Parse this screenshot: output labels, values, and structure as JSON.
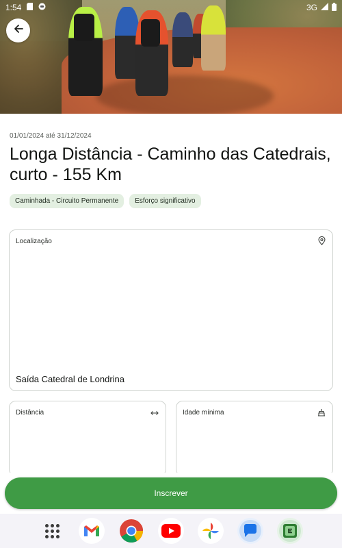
{
  "status_bar": {
    "time": "1:54",
    "network": "3G"
  },
  "hero": {
    "image": "hikers-walking-on-red-dirt-road"
  },
  "event": {
    "dates": "01/01/2024 até 31/12/2024",
    "title": "Longa Distância - Caminho das Catedrais, curto - 155 Km",
    "tags": [
      "Caminhada - Circuito Permanente",
      "Esforço significativo"
    ]
  },
  "location": {
    "label": "Localização",
    "icon": "location-pin-icon",
    "value": "Saída Catedral de Londrina"
  },
  "distance": {
    "label": "Distância",
    "icon": "horizontal-arrows-icon"
  },
  "min_age": {
    "label": "Idade mínima",
    "icon": "cake-icon"
  },
  "actions": {
    "register_label": "Inscrever"
  },
  "dock": {
    "apps": [
      "app-drawer",
      "gmail",
      "chrome",
      "youtube",
      "photos",
      "messages",
      "e2-app"
    ]
  },
  "colors": {
    "primary": "#3f9b45",
    "chip_bg": "#e3efe1",
    "card_border": "#cfd3cf"
  }
}
